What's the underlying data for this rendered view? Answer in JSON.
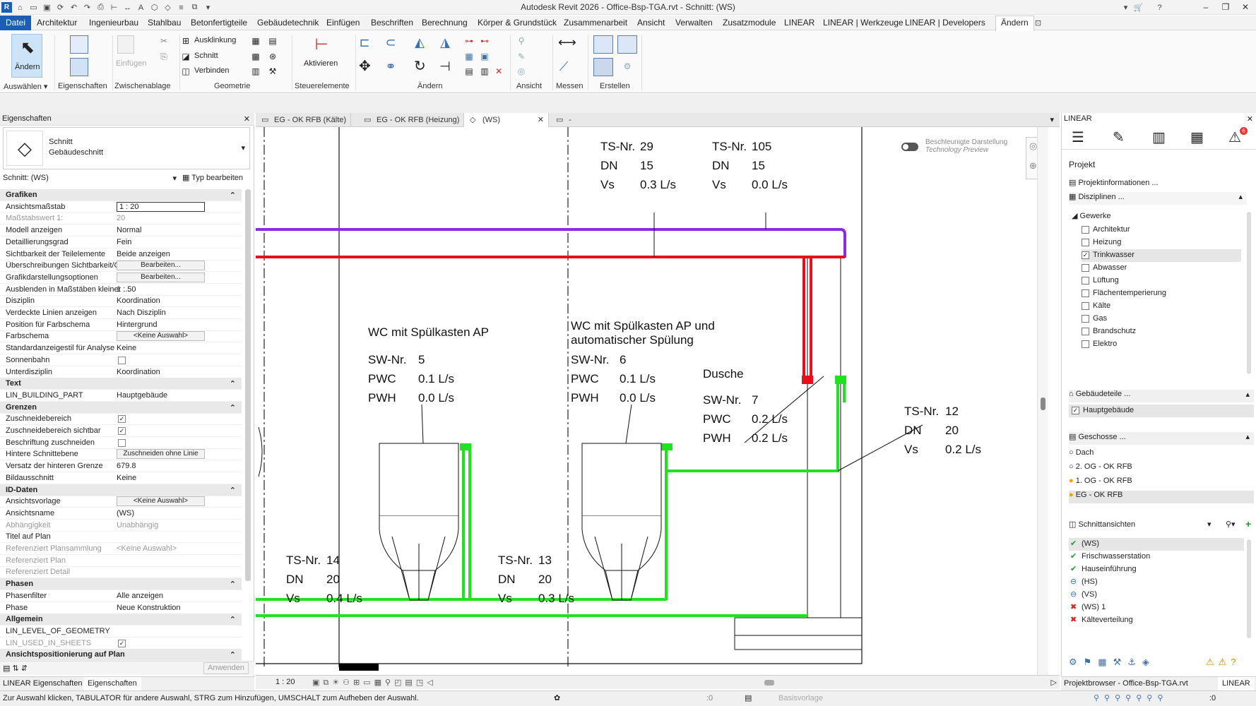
{
  "titlebar": {
    "title": "Autodesk Revit 2026 - Office-Bsp-TGA.rvt - Schnitt:  (WS)"
  },
  "menu": {
    "file": "Datei",
    "items": [
      "Architektur",
      "Ingenieurbau",
      "Stahlbau",
      "Betonfertigteile",
      "Gebäudetechnik",
      "Einfügen",
      "Beschriften",
      "Berechnung",
      "Körper & Grundstück",
      "Zusammenarbeit",
      "Ansicht",
      "Verwalten",
      "Zusatzmodule",
      "LINEAR",
      "LINEAR | Werkzeuge",
      "LINEAR | Developers"
    ],
    "active": "Ändern"
  },
  "ribbon": {
    "aendern": "Ändern",
    "eigenschaften": "Eigenschaften",
    "einfuegen": "Einfügen",
    "ausklinkung": "Ausklinkung",
    "schnitt": "Schnitt",
    "verbinden": "Verbinden",
    "aktivieren": "Aktivieren",
    "panels": {
      "auswaehlen": "Auswählen",
      "eigenschaften": "Eigenschaften",
      "zwischenablage": "Zwischenablage",
      "geometrie": "Geometrie",
      "steuerelemente": "Steuerelemente",
      "aendern": "Ändern",
      "ansicht": "Ansicht",
      "messen": "Messen",
      "erstellen": "Erstellen"
    }
  },
  "props": {
    "title": "Eigenschaften",
    "type_line1": "Schnitt",
    "type_line2": "Gebäudeschnitt",
    "selector": "Schnitt: (WS)",
    "edit_type": "Typ bearbeiten",
    "apply": "Anwenden",
    "tab1": "LINEAR Eigenschaften",
    "tab2": "Eigenschaften",
    "rows": [
      {
        "k": "Grafiken",
        "sect": true
      },
      {
        "k": "Ansichtsmaßstab",
        "v": "1 : 20",
        "input": true
      },
      {
        "k": "Maßstabswert 1:",
        "v": "20",
        "dim": true
      },
      {
        "k": "Modell anzeigen",
        "v": "Normal"
      },
      {
        "k": "Detaillierungsgrad",
        "v": "Fein"
      },
      {
        "k": "Sichtbarkeit der Teilelemente",
        "v": "Beide anzeigen"
      },
      {
        "k": "Überschreibungen Sichtbarkeit/Gr...",
        "v": "Bearbeiten...",
        "btn": true
      },
      {
        "k": "Grafikdarstellungsoptionen",
        "v": "Bearbeiten...",
        "btn": true
      },
      {
        "k": "Ausblenden in Maßstäben kleiner ...",
        "v": "1 : 50"
      },
      {
        "k": "Disziplin",
        "v": "Koordination"
      },
      {
        "k": "Verdeckte Linien anzeigen",
        "v": "Nach Disziplin"
      },
      {
        "k": "Position für Farbschema",
        "v": "Hintergrund"
      },
      {
        "k": "Farbschema",
        "v": "<Keine Auswahl>",
        "btn": true
      },
      {
        "k": "Standardanzeigestil für Analyse",
        "v": "Keine"
      },
      {
        "k": "Sonnenbahn",
        "chk": ""
      },
      {
        "k": "Unterdisziplin",
        "v": "Koordination"
      },
      {
        "k": "Text",
        "sect": true
      },
      {
        "k": "LIN_BUILDING_PART",
        "v": "Hauptgebäude"
      },
      {
        "k": "Grenzen",
        "sect": true
      },
      {
        "k": "Zuschneidebereich",
        "chk": "✓"
      },
      {
        "k": "Zuschneidebereich sichtbar",
        "chk": "✓"
      },
      {
        "k": "Beschriftung zuschneiden",
        "chk": ""
      },
      {
        "k": "Hintere Schnittebene",
        "v": "Zuschneiden ohne Linie",
        "btn": true
      },
      {
        "k": "Versatz der hinteren Grenze",
        "v": "679.8"
      },
      {
        "k": "Bildausschnitt",
        "v": "Keine"
      },
      {
        "k": "ID-Daten",
        "sect": true
      },
      {
        "k": "Ansichtsvorlage",
        "v": "<Keine Auswahl>",
        "btn": true
      },
      {
        "k": "Ansichtsname",
        "v": "(WS)"
      },
      {
        "k": "Abhängigkeit",
        "v": "Unabhängig",
        "dim": true
      },
      {
        "k": "Titel auf Plan",
        "v": ""
      },
      {
        "k": "Referenziert Plansammlung",
        "v": "<Keine Auswahl>",
        "dim": true
      },
      {
        "k": "Referenziert Plan",
        "v": "",
        "dim": true
      },
      {
        "k": "Referenziert Detail",
        "v": "",
        "dim": true
      },
      {
        "k": "Phasen",
        "sect": true
      },
      {
        "k": "Phasenfilter",
        "v": "Alle anzeigen"
      },
      {
        "k": "Phase",
        "v": "Neue Konstruktion"
      },
      {
        "k": "Allgemein",
        "sect": true
      },
      {
        "k": "LIN_LEVEL_OF_GEOMETRY",
        "v": ""
      },
      {
        "k": "LIN_USED_IN_SHEETS",
        "chk": "✓",
        "dim": true
      },
      {
        "k": "Ansichtspositionierung auf Plan",
        "sect": true
      }
    ]
  },
  "tabs": [
    {
      "label": "EG - OK RFB (Kälte)"
    },
    {
      "label": "EG - OK RFB (Heizung)"
    },
    {
      "label": "(WS)",
      "active": true
    },
    {
      "label": "-"
    }
  ],
  "view": {
    "toggle_line1": "Beschleunigte Darstellung",
    "toggle_line2": "Technology Preview",
    "scale": "1 : 20",
    "tags": {
      "ts29": {
        "k1": "TS-Nr.",
        "v1": "29",
        "k2": "DN",
        "v2": "15",
        "k3": "Vs",
        "v3": "0.3 L/s"
      },
      "ts105": {
        "k1": "TS-Nr.",
        "v1": "105",
        "k2": "DN",
        "v2": "15",
        "k3": "Vs",
        "v3": "0.0 L/s"
      },
      "wc1": {
        "title": "WC mit Spülkasten AP",
        "k1": "SW-Nr.",
        "v1": "5",
        "k2": "PWC",
        "v2": "0.1 L/s",
        "k3": "PWH",
        "v3": "0.0 L/s"
      },
      "wc2": {
        "title1": "WC mit Spülkasten AP und",
        "title2": "automatischer Spülung",
        "k1": "SW-Nr.",
        "v1": "6",
        "k2": "PWC",
        "v2": "0.1 L/s",
        "k3": "PWH",
        "v3": "0.0 L/s"
      },
      "dusche": {
        "title": "Dusche",
        "k1": "SW-Nr.",
        "v1": "7",
        "k2": "PWC",
        "v2": "0.2 L/s",
        "k3": "PWH",
        "v3": "0.2 L/s"
      },
      "ts12": {
        "k1": "TS-Nr.",
        "v1": "12",
        "k2": "DN",
        "v2": "20",
        "k3": "Vs",
        "v3": "0.2 L/s"
      },
      "ts14": {
        "k1": "TS-Nr.",
        "v1": "14",
        "k2": "DN",
        "v2": "20",
        "k3": "Vs",
        "v3": "0.4 L/s"
      },
      "ts13": {
        "k1": "TS-Nr.",
        "v1": "13",
        "k2": "DN",
        "v2": "20",
        "k3": "Vs",
        "v3": "0.3 L/s"
      }
    }
  },
  "right": {
    "title": "LINEAR",
    "badge": "6",
    "projekt": "Projekt",
    "projektinfo": "Projektinformationen ...",
    "disziplinen": "Disziplinen ...",
    "gewerke": "Gewerke",
    "items": [
      {
        "label": "Architektur",
        "checked": ""
      },
      {
        "label": "Heizung",
        "checked": ""
      },
      {
        "label": "Trinkwasser",
        "checked": "✓",
        "sel": true
      },
      {
        "label": "Abwasser",
        "checked": ""
      },
      {
        "label": "Lüftung",
        "checked": ""
      },
      {
        "label": "Flächentemperierung",
        "checked": ""
      },
      {
        "label": "Kälte",
        "checked": ""
      },
      {
        "label": "Gas",
        "checked": ""
      },
      {
        "label": "Brandschutz",
        "checked": ""
      },
      {
        "label": "Elektro",
        "checked": ""
      }
    ],
    "gebaeudeteile": "Gebäudeteile ...",
    "hauptgebaeude": "Hauptgebäude",
    "geschosse": "Geschosse ...",
    "levels": [
      "Dach",
      "2. OG - OK RFB",
      "1. OG - OK RFB",
      "EG - OK RFB"
    ],
    "schnittansichten": "Schnittansichten",
    "sections": [
      {
        "label": "(WS)",
        "status": "ok",
        "sel": true
      },
      {
        "label": "Frischwasserstation",
        "status": "ok"
      },
      {
        "label": "Hauseinführung",
        "status": "ok"
      },
      {
        "label": "(HS)",
        "status": "minus"
      },
      {
        "label": "(VS)",
        "status": "minus"
      },
      {
        "label": "(WS)  1",
        "status": "err"
      },
      {
        "label": "Kälteverteilung",
        "status": "err"
      }
    ],
    "footer_tab1": "Projektbrowser - Office-Bsp-TGA.rvt",
    "footer_tab2": "LINEAR"
  },
  "status": {
    "text": "Zur Auswahl klicken, TABULATOR für andere Auswahl, STRG zum Hinzufügen, UMSCHALT zum Aufheben der Auswahl.",
    "zero1": ":0",
    "basis": "Basisvorlage",
    "zero2": ":0"
  },
  "colors": {
    "purple": "#8a2be2",
    "red": "#e8101a",
    "green": "#22e022",
    "accent": "#1b5fb4"
  }
}
